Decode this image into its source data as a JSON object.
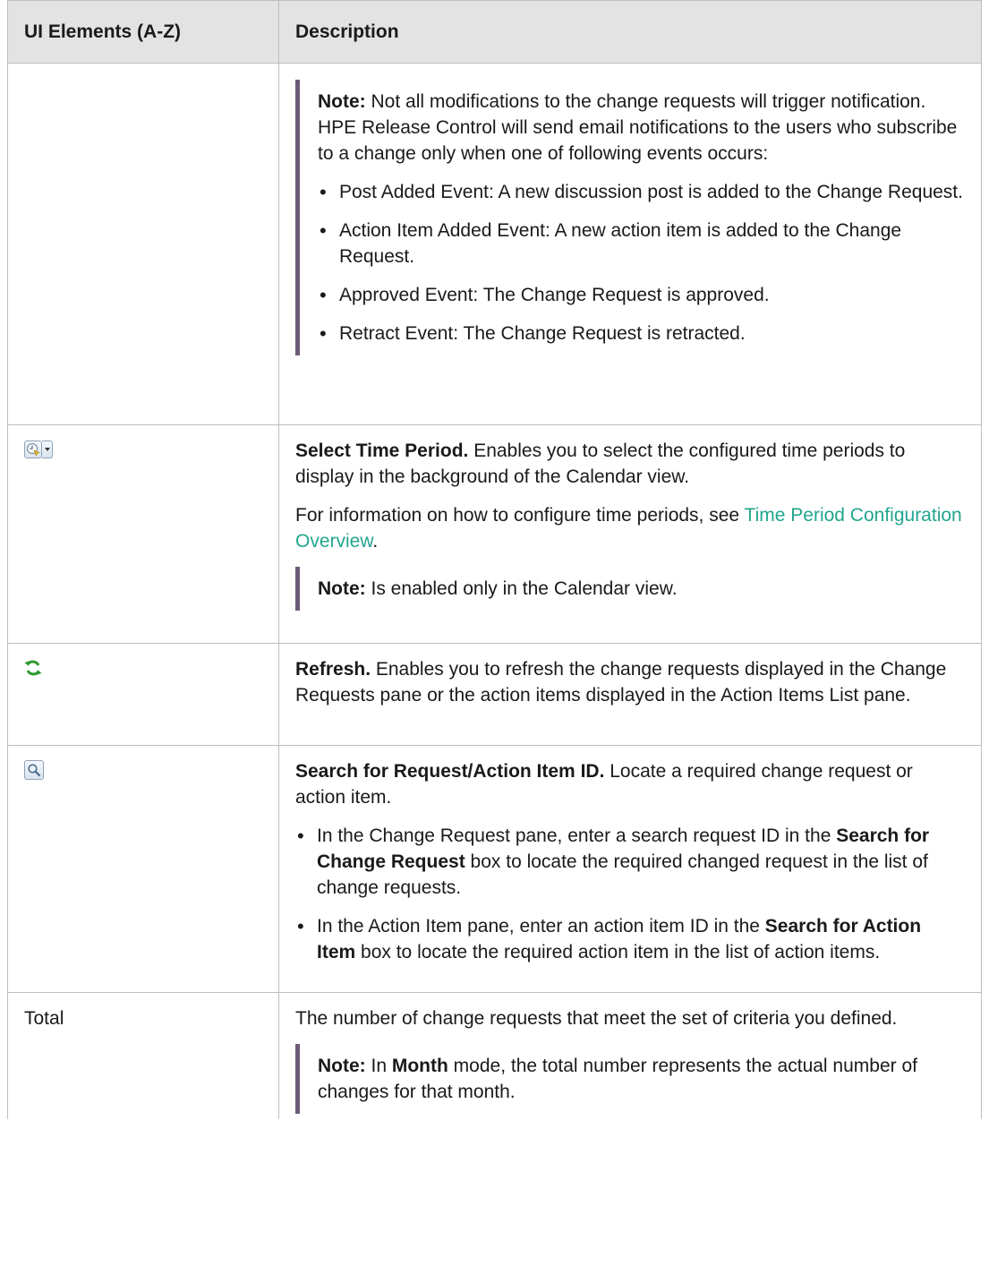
{
  "table": {
    "headers": [
      "UI Elements (A-Z)",
      "Description"
    ],
    "row0": {
      "note_label": "Note:",
      "note_text": " Not all modifications to the change requests will trigger notification. HPE Release Control will send email notifications to the users who subscribe to a change only when one of following events occurs:",
      "items": [
        "Post Added Event: A new discussion post is added to the Change Request.",
        "Action Item Added Event: A new action item is added to the Change Request.",
        "Approved Event: The Change Request is approved.",
        "Retract Event: The Change Request is retracted."
      ]
    },
    "row1": {
      "icon": "time-period-icon",
      "title": "Select Time Period.",
      "text": " Enables you to select the configured time periods to display in the background of the Calendar view.",
      "info_prefix": "For information on how to configure time periods, see ",
      "link": "Time Period Configuration Overview",
      "info_suffix": ".",
      "note_label": "Note:",
      "note_text": " Is enabled only in the Calendar view."
    },
    "row2": {
      "icon": "refresh-icon",
      "title": "Refresh.",
      "text": " Enables you to refresh the change requests displayed in the Change Requests pane or the action items displayed in the Action Items List pane."
    },
    "row3": {
      "icon": "search-icon",
      "title": "Search for Request/Action Item ID.",
      "text": " Locate a required change request or action item.",
      "b1_pre": "In the Change Request pane, enter a search request ID in the ",
      "b1_bold": "Search for Change Request",
      "b1_post": " box to locate the required changed request in the list of change requests.",
      "b2_pre": "In the Action Item pane, enter an action item ID in the ",
      "b2_bold": "Search for Action Item",
      "b2_post": " box to locate the required action item in the list of action items."
    },
    "row4": {
      "element": "Total",
      "text": "The number of change requests that meet the set of criteria you defined.",
      "note_label": "Note:",
      "note_pre": " In ",
      "note_bold": "Month",
      "note_post": " mode, the total number represents the actual number of changes for that month."
    }
  },
  "colors": {
    "header_bg": "#e3e3e3",
    "note_bar": "#6b5b77",
    "link": "#22a58e",
    "refresh_green": "#2e9a2e"
  }
}
